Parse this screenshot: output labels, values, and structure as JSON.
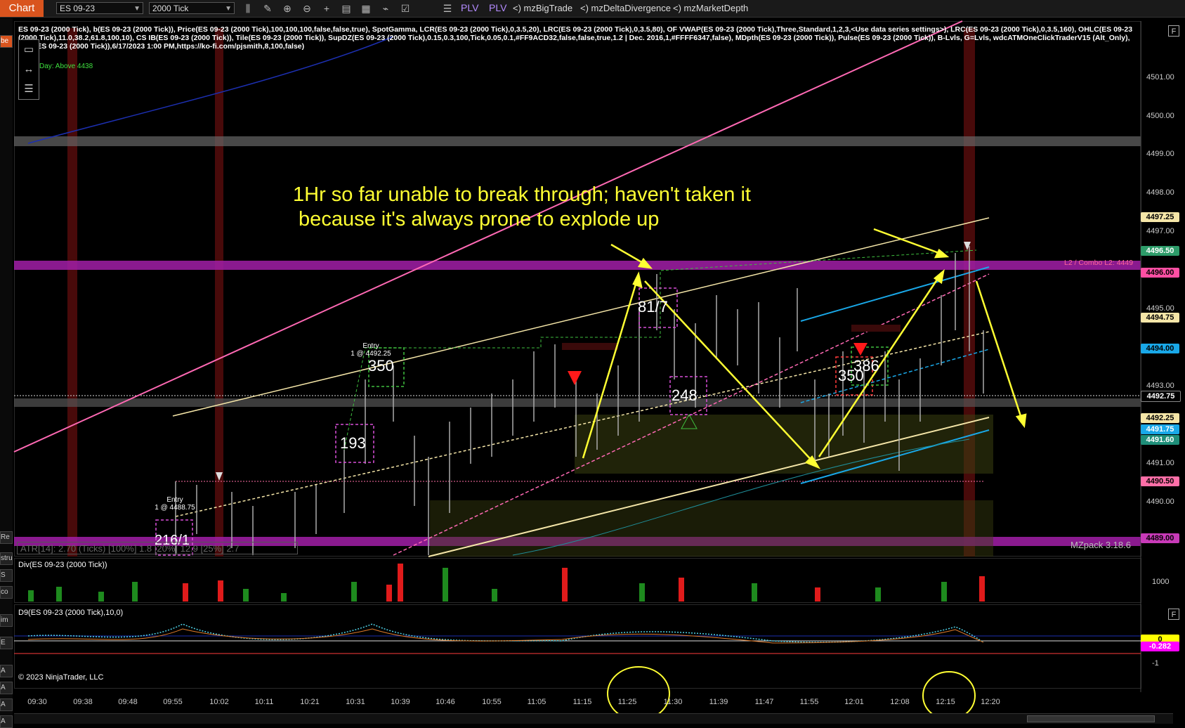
{
  "toolbar": {
    "tab_label": "Chart",
    "instrument": "ES 09-23",
    "interval": "2000 Tick",
    "plv1": "PLV",
    "plv2": "PLV",
    "indicator1": "<) mzBigTrade",
    "indicator2": "<) mzDeltaDivergence",
    "indicator3": "<) mzMarketDepth"
  },
  "left_strip": [
    "Re",
    "stru",
    "S",
    "co",
    "im",
    "E",
    "A",
    "A",
    "A",
    "A"
  ],
  "header": {
    "text": "ES 09-23 (2000 Tick), b(ES 09-23 (2000 Tick)), Price(ES 09-23 (2000 Tick),100,100,100,false,false,true), SpotGamma, LCR(ES 09-23 (2000 Tick),0,3.5,20), LRC(ES 09-23 (2000 Tick),0,3.5,80), OF VWAP(ES 09-23 (2000 Tick),Three,Standard,1,2,3,<Use data series settings>), LRC(ES 09-23 (2000 Tick),0,3.5,160), OHLC(ES 09-23 (2000 Tick),11.0,38.2,61.8,100,10), CS IB(ES 09-23 (2000 Tick)), Tile(ES 09-23 (2000 Tick)), SupDZ(ES 09-23 (2000 Tick),0.15,0.3,100,Tick,0.05,0.1,#FF9ACD32,false,false,true,1.2 | Dec. 2016,1,#FFFF6347,false), MDpth(ES 09-23 (2000 Tick)), Pulse(ES 09-23 (2000 Tick)), B-Lvls, G=Lvls, wdcATMOneClickTraderV15 (Alt_Only), pjsR(ES 09-23 (2000 Tick)),6/17/2023 1:00 PM,https://ko-fi.com/pjsmith,8,100,false)",
    "day_label": "Day: Above 4438",
    "f_button": "F"
  },
  "annotation": {
    "line1": "1Hr so far unable to break through; haven't taken it",
    "line2": " because it's always prone to explode up"
  },
  "price_axis": {
    "labels": [
      {
        "text": "4501.00"
      },
      {
        "text": "4500.00"
      },
      {
        "text": "4499.00"
      },
      {
        "text": "4498.00"
      },
      {
        "text": "4497.00"
      },
      {
        "text": "4495.00"
      },
      {
        "text": "4493.00"
      },
      {
        "text": "4491.00"
      },
      {
        "text": "4490.00"
      }
    ],
    "tags": [
      {
        "text": "4497.25",
        "color": "#f5e6a8"
      },
      {
        "text": "4496.50",
        "color": "#2e9c6a"
      },
      {
        "text": "4496.00",
        "color": "#ff4fa3"
      },
      {
        "text": "4494.75",
        "color": "#f5e6a8"
      },
      {
        "text": "4494.00",
        "color": "#19a8e8"
      },
      {
        "text": "4492.75",
        "color": "#000000"
      },
      {
        "text": "4492.25",
        "color": "#f5e6a8"
      },
      {
        "text": "4491.75",
        "color": "#19a8e8"
      },
      {
        "text": "4491.60",
        "color": "#1f8f7a"
      },
      {
        "text": "4490.50",
        "color": "#ff6fa8"
      },
      {
        "text": "4489.00",
        "color": "#c83ab8"
      }
    ]
  },
  "labels": {
    "combo": "L2 / Combo L2: 4449",
    "mzpack": "MZpack 3.18.6",
    "atr": "ATR[14]: 2.70 (Ticks) [100%] 1.8 [20%] 12.9 [25%] 2.7",
    "copyright": "© 2023 NinjaTrader, LLC",
    "entry1": "Entry",
    "entry1_detail": "1 @ 4492.25",
    "entry2": "Entry",
    "entry2_detail": "1 @ 4488.75",
    "box_350a": "350",
    "box_193": "193",
    "box_817": "81/7",
    "box_248": "248",
    "box_350b": "350",
    "box_386": "386",
    "box_216": "216/1"
  },
  "subpanel1": {
    "title": "Div(ES 09-23 (2000 Tick))",
    "axis": "1000"
  },
  "subpanel2": {
    "title": "D9(ES 09-23 (2000 Tick),10,0)",
    "axis1": "0",
    "axis2": "-0.282",
    "axis3": "-1"
  },
  "time_axis": [
    "09:30",
    "09:38",
    "09:48",
    "09:55",
    "10:02",
    "10:11",
    "10:21",
    "10:31",
    "10:39",
    "10:46",
    "10:55",
    "11:05",
    "11:15",
    "11:25",
    "11:30",
    "11:39",
    "11:47",
    "11:55",
    "12:01",
    "12:08",
    "12:15",
    "12:20"
  ]
}
